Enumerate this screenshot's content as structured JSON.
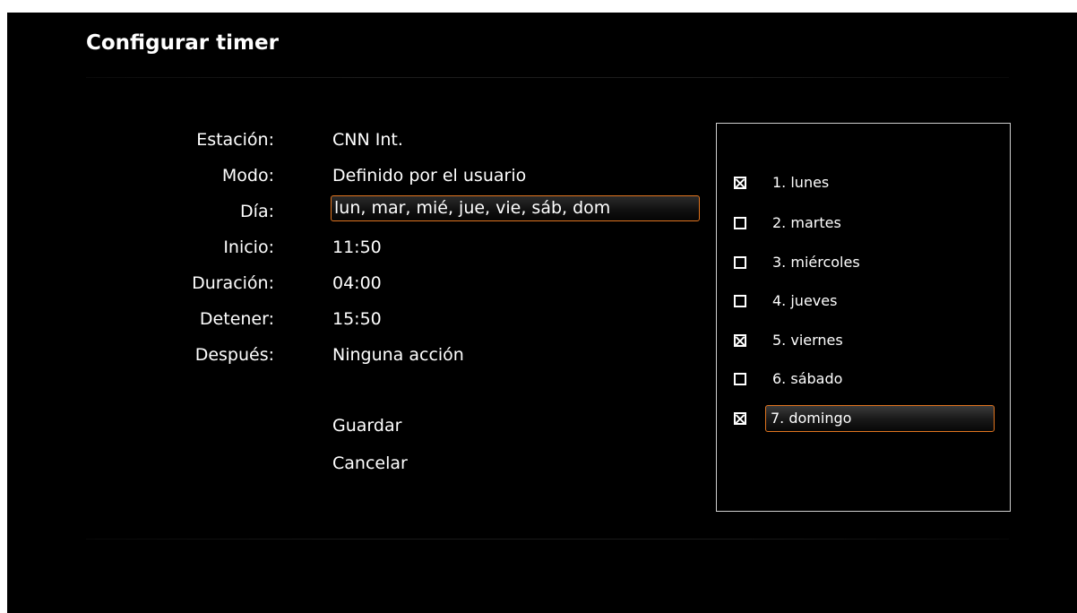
{
  "title": "Configurar timer",
  "fields": {
    "station": {
      "label": "Estación:",
      "value": "CNN Int."
    },
    "mode": {
      "label": "Modo:",
      "value": "Definido por el usuario"
    },
    "day": {
      "label": "Día:",
      "value": "lun, mar, mié, jue, vie, sáb, dom"
    },
    "start": {
      "label": "Inicio:",
      "value": "11:50"
    },
    "duration": {
      "label": "Duración:",
      "value": "04:00"
    },
    "stop": {
      "label": "Detener:",
      "value": "15:50"
    },
    "after": {
      "label": "Después:",
      "value": "Ninguna acción"
    }
  },
  "actions": {
    "save": "Guardar",
    "cancel": "Cancelar"
  },
  "day_options": [
    {
      "label": "1. lunes",
      "checked": true
    },
    {
      "label": "2. martes",
      "checked": false
    },
    {
      "label": "3. miércoles",
      "checked": false
    },
    {
      "label": "4. jueves",
      "checked": false
    },
    {
      "label": "5. viernes",
      "checked": true
    },
    {
      "label": "6. sábado",
      "checked": false
    },
    {
      "label": "7. domingo",
      "checked": true
    }
  ],
  "selected_day_index": 6,
  "colors": {
    "background": "#000000",
    "text": "#ffffff",
    "focus_accent": "#e0741f",
    "popup_border": "#cfcfcf"
  }
}
